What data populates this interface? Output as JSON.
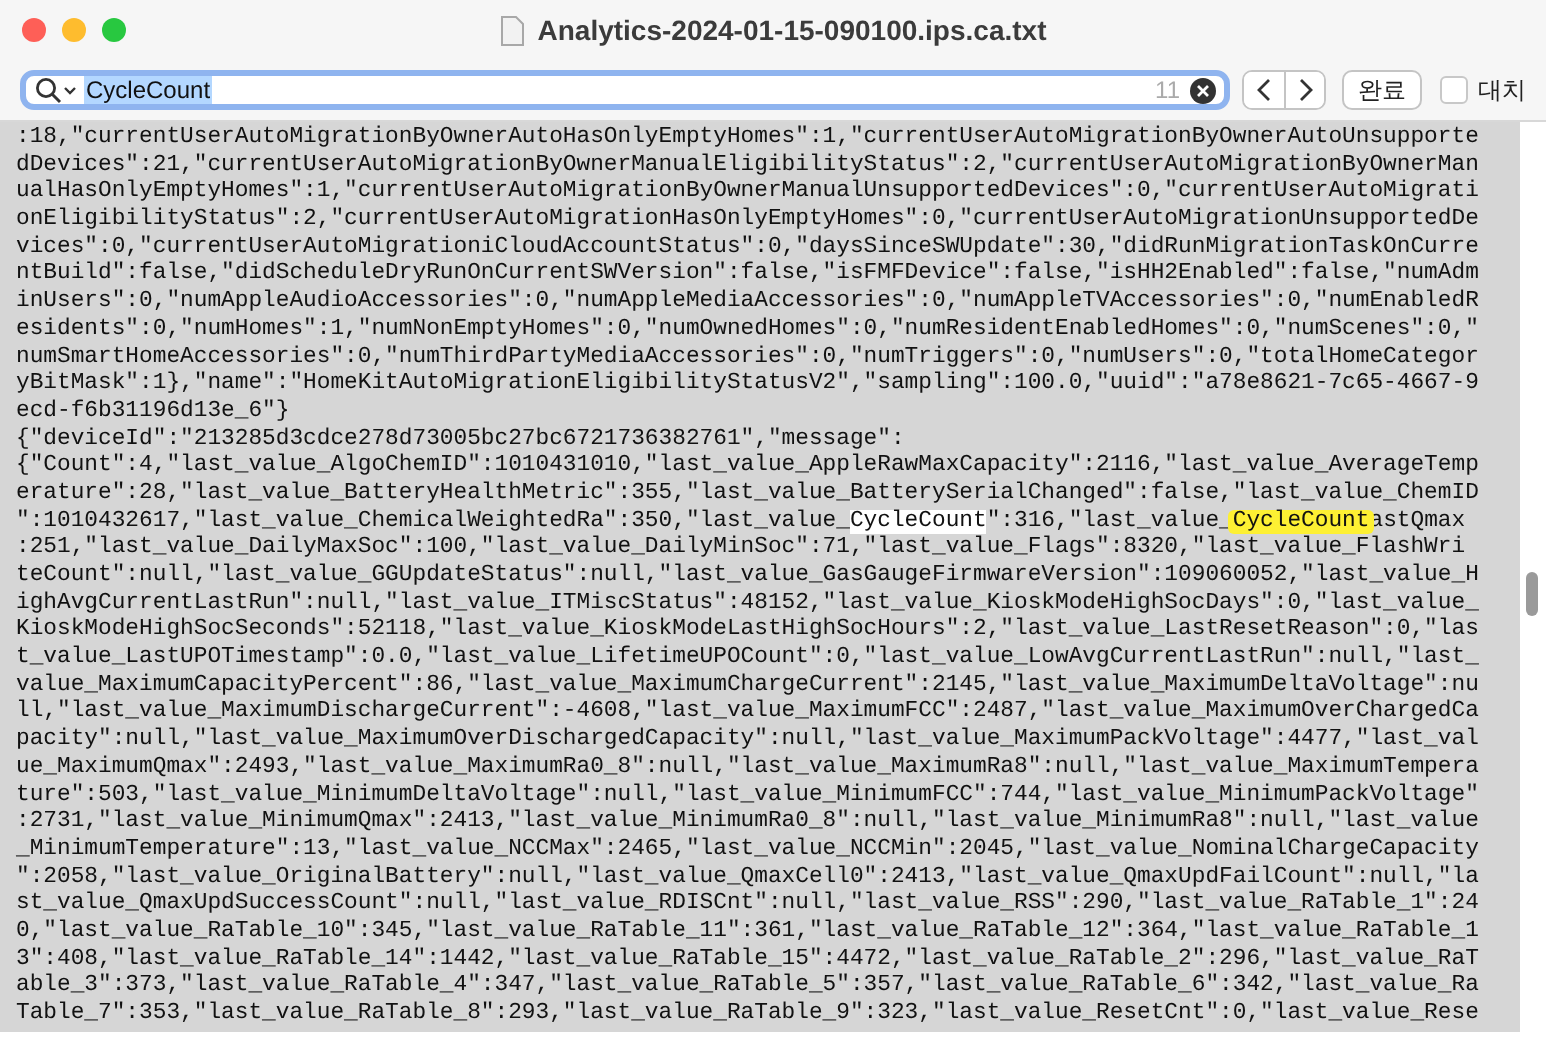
{
  "window": {
    "title": "Analytics-2024-01-15-090100.ips.ca.txt"
  },
  "find_bar": {
    "query": "CycleCount",
    "query_selected": true,
    "match_count": "11",
    "done_button": "완료",
    "replace": {
      "label": "대치",
      "checked": false
    }
  },
  "lines": [
    {
      "text": ":18,\"currentUserAutoMigrationByOwnerAutoHasOnlyEmptyHomes\":1,\"currentUserAutoMigrationByOwnerAutoUnsupporte"
    },
    {
      "text": "dDevices\":21,\"currentUserAutoMigrationByOwnerManualEligibilityStatus\":2,\"currentUserAutoMigrationByOwnerMan"
    },
    {
      "text": "ualHasOnlyEmptyHomes\":1,\"currentUserAutoMigrationByOwnerManualUnsupportedDevices\":0,\"currentUserAutoMigrati"
    },
    {
      "text": "onEligibilityStatus\":2,\"currentUserAutoMigrationHasOnlyEmptyHomes\":0,\"currentUserAutoMigrationUnsupportedDe"
    },
    {
      "text": "vices\":0,\"currentUserAutoMigrationiCloudAccountStatus\":0,\"daysSinceSWUpdate\":30,\"didRunMigrationTaskOnCurre"
    },
    {
      "text": "ntBuild\":false,\"didScheduleDryRunOnCurrentSWVersion\":false,\"isFMFDevice\":false,\"isHH2Enabled\":false,\"numAdm"
    },
    {
      "text": "inUsers\":0,\"numAppleAudioAccessories\":0,\"numAppleMediaAccessories\":0,\"numAppleTVAccessories\":0,\"numEnabledR"
    },
    {
      "text": "esidents\":0,\"numHomes\":1,\"numNonEmptyHomes\":0,\"numOwnedHomes\":0,\"numResidentEnabledHomes\":0,\"numScenes\":0,\""
    },
    {
      "text": "numSmartHomeAccessories\":0,\"numThirdPartyMediaAccessories\":0,\"numTriggers\":0,\"numUsers\":0,\"totalHomeCategor"
    },
    {
      "text": "yBitMask\":1},\"name\":\"HomeKitAutoMigrationEligibilityStatusV2\",\"sampling\":100.0,\"uuid\":\"a78e8621-7c65-4667-9"
    },
    {
      "text": "ecd-f6b31196d13e_6\"}"
    },
    {
      "text": "{\"deviceId\":\"213285d3cdce278d73005bc27bc6721736382761\",\"message\":"
    },
    {
      "text": "{\"Count\":4,\"last_value_AlgoChemID\":1010431010,\"last_value_AppleRawMaxCapacity\":2116,\"last_value_AverageTemp"
    },
    {
      "text": "erature\":28,\"last_value_BatteryHealthMetric\":355,\"last_value_BatterySerialChanged\":false,\"last_value_ChemID"
    },
    {
      "parts": [
        {
          "text": "\":1010432617,\"last_value_ChemicalWeightedRa\":350,\"last_value_",
          "match": false,
          "current": false
        },
        {
          "text": "CycleCount",
          "match": true,
          "current": false
        },
        {
          "text": "\":316,\"last_value_",
          "match": false,
          "current": false
        },
        {
          "text": "CycleCount",
          "match": true,
          "current": true
        },
        {
          "text": "astQmax",
          "match": false,
          "current": false
        }
      ]
    },
    {
      "text": ":251,\"last_value_DailyMaxSoc\":100,\"last_value_DailyMinSoc\":71,\"last_value_Flags\":8320,\"last_value_FlashWri"
    },
    {
      "text": "teCount\":null,\"last_value_GGUpdateStatus\":null,\"last_value_GasGaugeFirmwareVersion\":109060052,\"last_value_H"
    },
    {
      "text": "ighAvgCurrentLastRun\":null,\"last_value_ITMiscStatus\":48152,\"last_value_KioskModeHighSocDays\":0,\"last_value_"
    },
    {
      "text": "KioskModeHighSocSeconds\":52118,\"last_value_KioskModeLastHighSocHours\":2,\"last_value_LastResetReason\":0,\"las"
    },
    {
      "text": "t_value_LastUPOTimestamp\":0.0,\"last_value_LifetimeUPOCount\":0,\"last_value_LowAvgCurrentLastRun\":null,\"last_"
    },
    {
      "text": "value_MaximumCapacityPercent\":86,\"last_value_MaximumChargeCurrent\":2145,\"last_value_MaximumDeltaVoltage\":nu"
    },
    {
      "text": "ll,\"last_value_MaximumDischargeCurrent\":-4608,\"last_value_MaximumFCC\":2487,\"last_value_MaximumOverChargedCa"
    },
    {
      "text": "pacity\":null,\"last_value_MaximumOverDischargedCapacity\":null,\"last_value_MaximumPackVoltage\":4477,\"last_val"
    },
    {
      "text": "ue_MaximumQmax\":2493,\"last_value_MaximumRa0_8\":null,\"last_value_MaximumRa8\":null,\"last_value_MaximumTempera"
    },
    {
      "text": "ture\":503,\"last_value_MinimumDeltaVoltage\":null,\"last_value_MinimumFCC\":744,\"last_value_MinimumPackVoltage\""
    },
    {
      "text": ":2731,\"last_value_MinimumQmax\":2413,\"last_value_MinimumRa0_8\":null,\"last_value_MinimumRa8\":null,\"last_value"
    },
    {
      "text": "_MinimumTemperature\":13,\"last_value_NCCMax\":2465,\"last_value_NCCMin\":2045,\"last_value_NominalChargeCapacity"
    },
    {
      "text": "\":2058,\"last_value_OriginalBattery\":null,\"last_value_QmaxCell0\":2413,\"last_value_QmaxUpdFailCount\":null,\"la"
    },
    {
      "text": "st_value_QmaxUpdSuccessCount\":null,\"last_value_RDISCnt\":null,\"last_value_RSS\":290,\"last_value_RaTable_1\":24"
    },
    {
      "text": "0,\"last_value_RaTable_10\":345,\"last_value_RaTable_11\":361,\"last_value_RaTable_12\":364,\"last_value_RaTable_1"
    },
    {
      "text": "3\":408,\"last_value_RaTable_14\":1442,\"last_value_RaTable_15\":4472,\"last_value_RaTable_2\":296,\"last_value_RaT"
    },
    {
      "text": "able_3\":373,\"last_value_RaTable_4\":347,\"last_value_RaTable_5\":357,\"last_value_RaTable_6\":342,\"last_value_Ra"
    },
    {
      "text": "Table_7\":353,\"last_value_RaTable_8\":293,\"last_value_RaTable_9\":323,\"last_value_ResetCnt\":0,\"last_value_Rese"
    }
  ]
}
